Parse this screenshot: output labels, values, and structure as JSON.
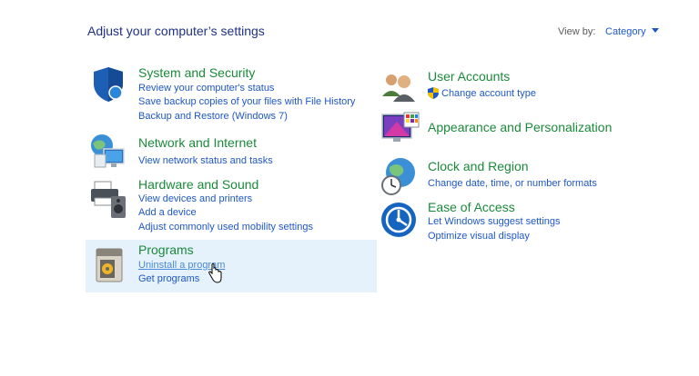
{
  "header": {
    "title": "Adjust your computer’s settings",
    "view_by_label": "View by:",
    "view_by_value": "Category"
  },
  "left": [
    {
      "title": "System and Security",
      "icon": "shield-icon",
      "links": [
        "Review your computer's status",
        "Save backup copies of your files with File History",
        "Backup and Restore (Windows 7)"
      ]
    },
    {
      "title": "Network and Internet",
      "icon": "network-globe-icon",
      "links": [
        "View network status and tasks"
      ]
    },
    {
      "title": "Hardware and Sound",
      "icon": "printer-speaker-icon",
      "links": [
        "View devices and printers",
        "Add a device",
        "Adjust commonly used mobility settings"
      ]
    },
    {
      "title": "Programs",
      "icon": "programs-icon",
      "links": [
        "Uninstall a program",
        "Get programs"
      ]
    }
  ],
  "right": [
    {
      "title": "User Accounts",
      "icon": "users-icon",
      "links": [
        "Change account type"
      ]
    },
    {
      "title": "Appearance and Personalization",
      "icon": "monitor-palette-icon",
      "links": []
    },
    {
      "title": "Clock and Region",
      "icon": "clock-globe-icon",
      "links": [
        "Change date, time, or number formats"
      ]
    },
    {
      "title": "Ease of Access",
      "icon": "ease-of-access-icon",
      "links": [
        "Let Windows suggest settings",
        "Optimize visual display"
      ]
    }
  ]
}
